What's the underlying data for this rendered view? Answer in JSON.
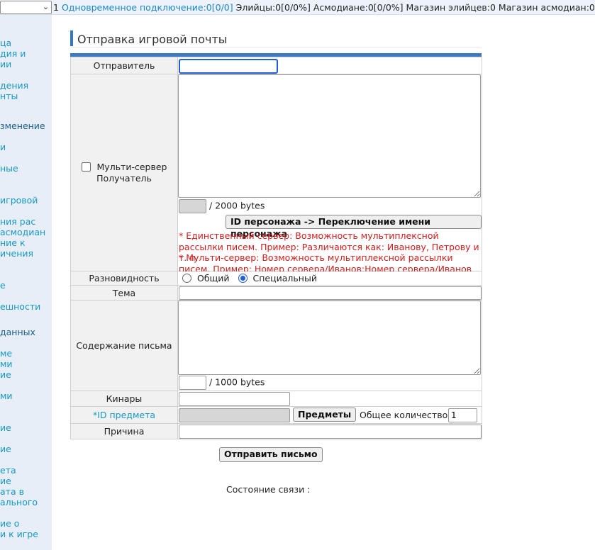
{
  "topbar": {
    "select_value": "1",
    "concurrent_label": "Одновременное подключение:0[0/0]",
    "stats": "Элийцы:0[0/0%] Асмодиане:0[0/0%] Магазин элийцев:0 Магазин асмодиан:0"
  },
  "sidebar": {
    "items": [
      {
        "text": "ца"
      },
      {
        "text": "дия и"
      },
      {
        "text": "ии"
      },
      {
        "text": "дения"
      },
      {
        "text": "нты"
      },
      {
        "text": "зменение"
      },
      {
        "text": "и"
      },
      {
        "text": "ные"
      },
      {
        "text": "игровой"
      },
      {
        "text": "ния рас"
      },
      {
        "text": "асмодиан"
      },
      {
        "text": "ние к"
      },
      {
        "text": "ичения"
      },
      {
        "text": "е"
      },
      {
        "text": "ешности"
      },
      {
        "text": "данных"
      },
      {
        "text": "ме"
      },
      {
        "text": "ми"
      },
      {
        "text": "ие"
      },
      {
        "text": "ми"
      },
      {
        "text": "ие"
      },
      {
        "text": "ие"
      },
      {
        "text": "ета"
      },
      {
        "text": "ие"
      },
      {
        "text": "ата в"
      },
      {
        "text": "ального"
      },
      {
        "text": "ие о"
      },
      {
        "text": "и к игре"
      }
    ]
  },
  "page": {
    "title": "Отправка игровой почты"
  },
  "form": {
    "sender_label": "Отправитель",
    "sender_value": "",
    "multi_server_label": "Мульти-сервер",
    "recipient_label": "Получатель",
    "recipients_value": "",
    "recipients_bytes_value": "",
    "recipients_bytes_suffix": "/ 2000 bytes",
    "switch_name_button": "ID персонажа -> Переключение имени персонажа",
    "note_single": "* Единственный сервер: Возможность мультиплексной рассылки писем. Пример: Различаются как: Иванову, Петрову и т. п.",
    "note_multi": "* Мульти-сервер: Возможность мультиплексной рассылки писем. Пример: Номер сервера/Иванов;Номер сервера/Иванов",
    "type_label": "Разновидность",
    "type_options": [
      {
        "label": "Общий",
        "selected": false
      },
      {
        "label": "Специальный",
        "selected": true
      }
    ],
    "subject_label": "Тема",
    "subject_value": "",
    "content_label": "Содержание письма",
    "content_value": "",
    "content_bytes_value": "",
    "content_bytes_suffix": "/ 1000 bytes",
    "kinah_label": "Кинары",
    "kinah_value": "",
    "item_id_label": "*ID предмета",
    "item_id_value": "",
    "items_button": "Предметы",
    "total_qty_label": "Общее количество",
    "total_qty_value": "1",
    "reason_label": "Причина",
    "reason_value": ""
  },
  "footer": {
    "send_button": "Отправить письмо",
    "connection_status_label": "Состояние связи :"
  },
  "colors": {
    "accent": "#2f78c4",
    "link": "#1797c4",
    "note": "#d11c1c",
    "sidebar_bg": "#e7eef8"
  }
}
